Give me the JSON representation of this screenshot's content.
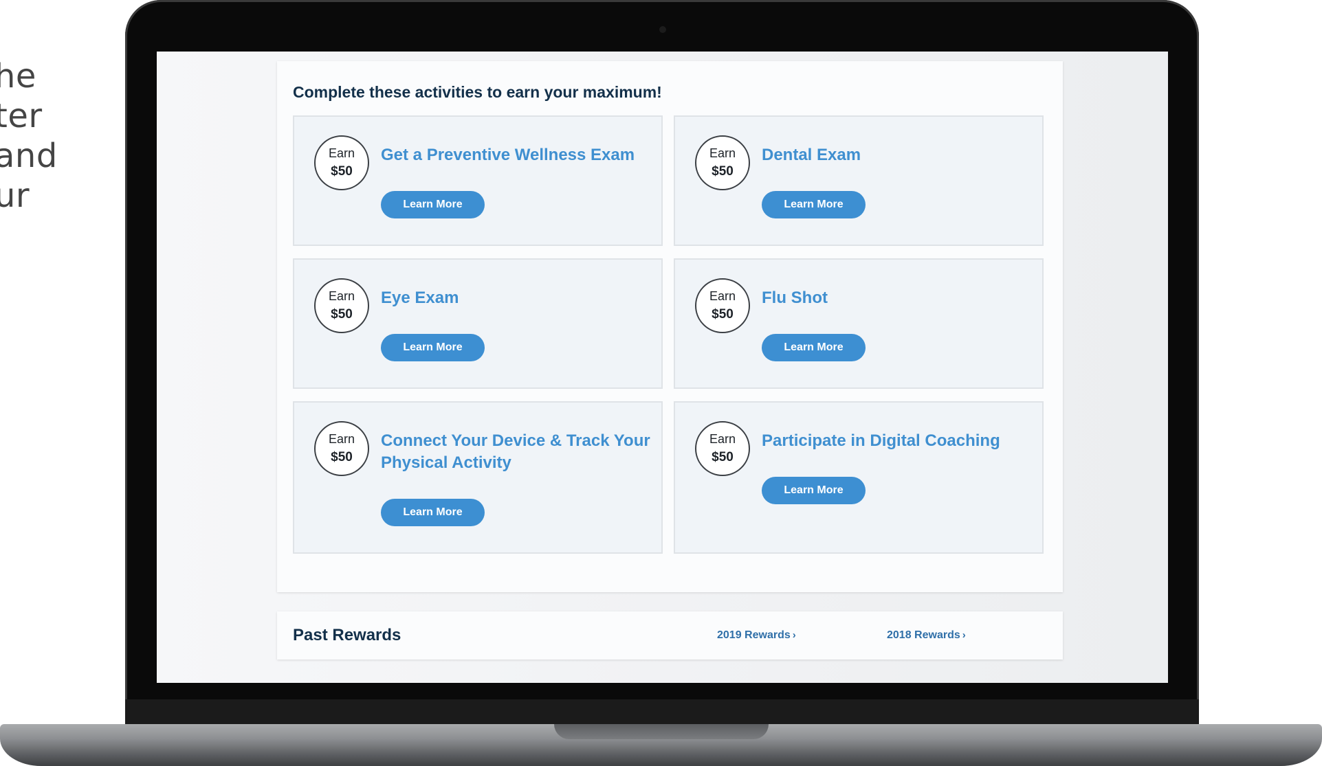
{
  "side_text": {
    "lines": [
      "he",
      "ter",
      "and",
      "ur"
    ]
  },
  "panel": {
    "title": "Complete these activities to earn your maximum!"
  },
  "activities": [
    {
      "earn_label": "Earn",
      "amount": "$50",
      "title": "Get a Preventive Wellness Exam",
      "button": "Learn More"
    },
    {
      "earn_label": "Earn",
      "amount": "$50",
      "title": "Dental Exam",
      "button": "Learn More"
    },
    {
      "earn_label": "Earn",
      "amount": "$50",
      "title": "Eye Exam",
      "button": "Learn More"
    },
    {
      "earn_label": "Earn",
      "amount": "$50",
      "title": "Flu Shot",
      "button": "Learn More"
    },
    {
      "earn_label": "Earn",
      "amount": "$50",
      "title": "Connect Your Device & Track Your Physical Activity",
      "button": "Learn More"
    },
    {
      "earn_label": "Earn",
      "amount": "$50",
      "title": "Participate in Digital Coaching",
      "button": "Learn More"
    }
  ],
  "past_rewards": {
    "title": "Past Rewards",
    "links": [
      "2019 Rewards",
      "2018 Rewards"
    ],
    "chevron": "›"
  },
  "colors": {
    "accent": "#3d8fd2",
    "heading": "#13304a",
    "card_bg": "#f0f4f8"
  }
}
